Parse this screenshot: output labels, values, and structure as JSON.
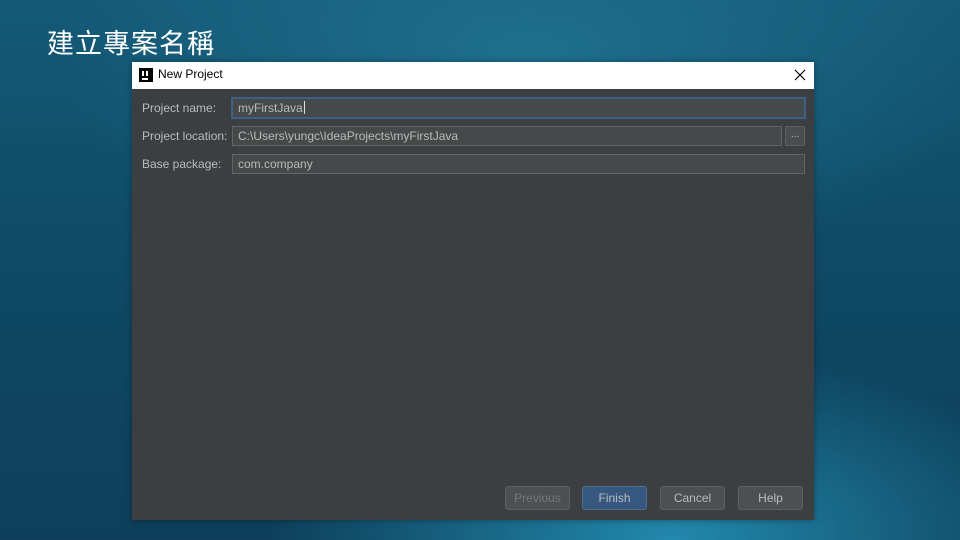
{
  "slide": {
    "title": "建立專案名稱"
  },
  "dialog": {
    "title": "New Project",
    "app_icon": "intellij-idea-icon",
    "close_icon": "close-icon",
    "fields": {
      "project_name": {
        "label": "Project name:",
        "value": "myFirstJava"
      },
      "project_location": {
        "label": "Project location:",
        "value": "C:\\Users\\yungc\\IdeaProjects\\myFirstJava",
        "browse_label": "..."
      },
      "base_package": {
        "label": "Base package:",
        "value": "com.company"
      }
    },
    "buttons": {
      "previous": "Previous",
      "finish": "Finish",
      "cancel": "Cancel",
      "help": "Help"
    }
  },
  "colors": {
    "dialog_background": "#3c3f41",
    "field_background": "#45494a",
    "primary_button": "#365880",
    "label_text": "#bbbbbb"
  }
}
